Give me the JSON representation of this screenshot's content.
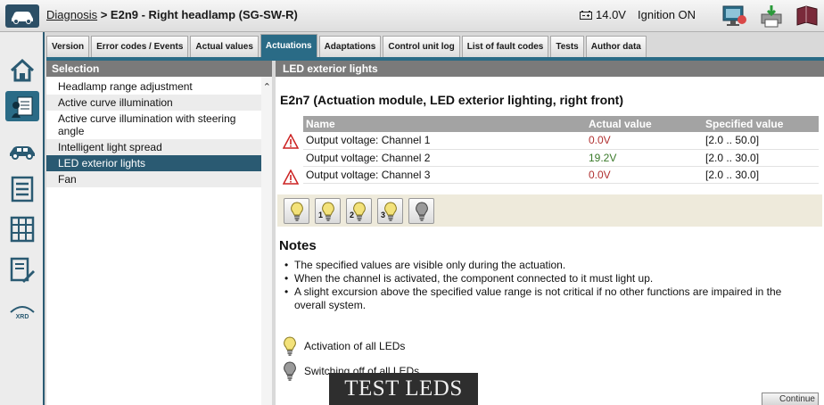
{
  "header": {
    "breadcrumb_link": "Diagnosis",
    "breadcrumb_rest": "> E2n9 - Right headlamp (SG-SW-R)",
    "battery_voltage": "14.0V",
    "ignition_status": "Ignition ON"
  },
  "rail": {
    "items": [
      "home-icon",
      "diagnosis-icon",
      "vehicle-icon",
      "list-icon",
      "grid-icon",
      "document-tools-icon",
      "xrd-icon"
    ],
    "xrd_label": "XRD"
  },
  "tabs": [
    {
      "label": "Version",
      "active": false
    },
    {
      "label": "Error codes / Events",
      "active": false
    },
    {
      "label": "Actual values",
      "active": false
    },
    {
      "label": "Actuations",
      "active": true
    },
    {
      "label": "Adaptations",
      "active": false
    },
    {
      "label": "Control unit log",
      "active": false
    },
    {
      "label": "List of fault codes",
      "active": false
    },
    {
      "label": "Tests",
      "active": false
    },
    {
      "label": "Author data",
      "active": false
    }
  ],
  "selection": {
    "header": "Selection",
    "items": [
      {
        "label": "Headlamp range adjustment",
        "state": "normal"
      },
      {
        "label": "Active curve illumination",
        "state": "shaded"
      },
      {
        "label": "Active curve illumination with steering angle",
        "state": "normal"
      },
      {
        "label": "Intelligent light spread",
        "state": "shaded"
      },
      {
        "label": "LED exterior lights",
        "state": "active"
      },
      {
        "label": "Fan",
        "state": "shaded"
      }
    ]
  },
  "main": {
    "header": "LED exterior lights",
    "module_title": "E2n7 (Actuation module, LED exterior lighting, right front)",
    "table": {
      "columns": [
        "Name",
        "Actual value",
        "Specified value"
      ],
      "rows": [
        {
          "name": "Output voltage: Channel 1",
          "actual": "0.0V",
          "specified": "[2.0 .. 50.0]",
          "warning": true,
          "status_color": "#b03030"
        },
        {
          "name": "Output voltage: Channel 2",
          "actual": "19.2V",
          "specified": "[2.0 .. 30.0]",
          "warning": false,
          "status_color": "#3a7a2a"
        },
        {
          "name": "Output voltage: Channel 3",
          "actual": "0.0V",
          "specified": "[2.0 .. 30.0]",
          "warning": true,
          "status_color": "#b03030"
        }
      ]
    },
    "bulb_buttons": [
      {
        "channel": "",
        "lit": true
      },
      {
        "channel": "1",
        "lit": true
      },
      {
        "channel": "2",
        "lit": true
      },
      {
        "channel": "3",
        "lit": true
      },
      {
        "channel": "",
        "lit": false
      }
    ],
    "notes": {
      "title": "Notes",
      "items": [
        "The specified values are visible only during the actuation.",
        "When the channel is activated, the component connected to it must light up.",
        "A slight excursion above the specified value range is not critical if no other functions are impaired in the overall system."
      ]
    },
    "legend": [
      {
        "label": "Activation of all LEDs",
        "lit": true
      },
      {
        "label": "Switching off of all LEDs",
        "lit": false
      }
    ]
  },
  "overlay": {
    "watermark": "TEST LEDS",
    "continue_label": "Continue"
  },
  "colors": {
    "accent": "#2a6b86",
    "selected_row": "#2a5a72",
    "header_gray": "#7a7a7a",
    "error_red": "#b03030",
    "ok_green": "#3a7a2a"
  }
}
